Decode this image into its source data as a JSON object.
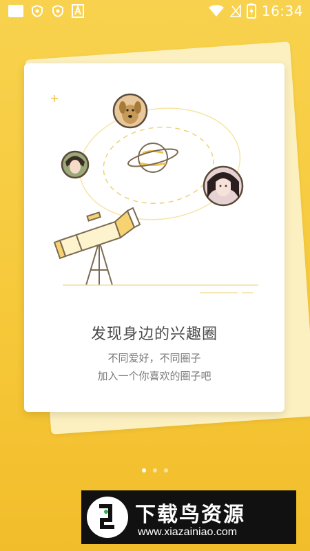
{
  "status_bar": {
    "time": "16:34",
    "icons": [
      "square-app-icon",
      "shield-icon",
      "shield-icon",
      "a-letter-icon",
      "wifi-icon",
      "no-signal-icon",
      "battery-charging-icon"
    ]
  },
  "onboarding": {
    "title": "发现身边的兴趣圈",
    "subtitle_line1": "不同爱好，不同圈子",
    "subtitle_line2": "加入一个你喜欢的圈子吧",
    "illustration_icons": [
      "dog-avatar",
      "girl-avatar",
      "woman-avatar",
      "planet-icon",
      "telescope-icon"
    ],
    "page_count": 3,
    "current_page": 1
  },
  "watermark": {
    "brand": "下载鸟资源",
    "url": "www.xiazainiao.com"
  },
  "colors": {
    "background": "#f6c93a",
    "accent_yellow": "#f0c24a",
    "card": "#ffffff",
    "text_primary": "#4a4a4a",
    "text_secondary": "#7a7a7a"
  }
}
